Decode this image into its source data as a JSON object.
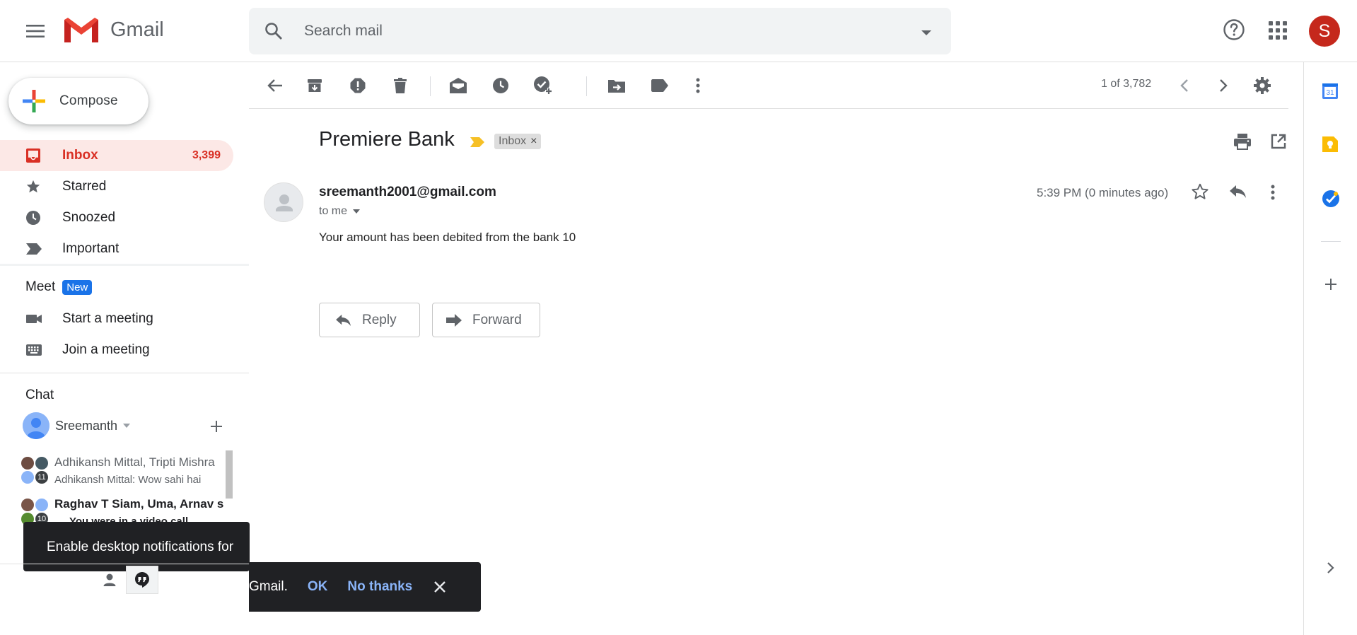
{
  "header": {
    "app_name": "Gmail",
    "search_placeholder": "Search mail",
    "account_initial": "S"
  },
  "sidebar": {
    "compose_label": "Compose",
    "items": [
      {
        "label": "Inbox",
        "count": "3,399",
        "icon": "inbox-icon",
        "active": true
      },
      {
        "label": "Starred",
        "count": "",
        "icon": "star-icon"
      },
      {
        "label": "Snoozed",
        "count": "",
        "icon": "clock-icon"
      },
      {
        "label": "Important",
        "count": "",
        "icon": "important-icon"
      }
    ],
    "meet": {
      "title": "Meet",
      "badge": "New",
      "start": "Start a meeting",
      "join": "Join a meeting"
    },
    "chat": {
      "title": "Chat",
      "user": "Sreemanth",
      "conversations": [
        {
          "title": "Adhikansh Mittal, Tripti Mishra",
          "subtitle": "Adhikansh Mittal: Wow sahi hai",
          "member_count": "11",
          "bold": false
        },
        {
          "title": "Raghav T Siam, Uma, Arnav si",
          "subtitle": "You were in a video call",
          "member_count": "10",
          "bold": true
        }
      ]
    },
    "tooltip": "Enable desktop notifications for"
  },
  "toolbar": {
    "pager": "1 of 3,782"
  },
  "email": {
    "subject": "Premiere Bank",
    "label": "Inbox",
    "sender": "sreemanth2001@gmail.com",
    "to": "to me",
    "time": "5:39 PM (0 minutes ago)",
    "body": "Your amount has been debited from the bank 10",
    "reply_label": "Reply",
    "forward_label": "Forward"
  },
  "snackbar": {
    "message": "Gmail.",
    "ok": "OK",
    "no_thanks": "No thanks"
  },
  "colors": {
    "accent_red": "#d93025",
    "active_bg": "#fce8e6",
    "link_blue": "#8ab4f8",
    "badge_blue": "#1a73e8"
  }
}
